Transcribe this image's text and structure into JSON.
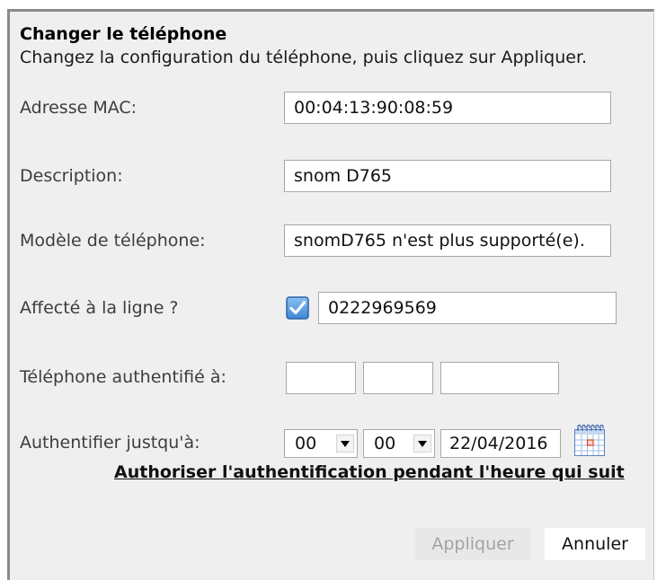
{
  "dialog": {
    "title": "Changer le téléphone",
    "subtitle": "Changez la configuration du téléphone, puis cliquez sur Appliquer."
  },
  "fields": {
    "mac": {
      "label": "Adresse MAC:",
      "value": "00:04:13:90:08:59"
    },
    "description": {
      "label": "Description:",
      "value": "snom D765"
    },
    "model": {
      "label": "Modèle de téléphone:",
      "value": "snomD765 n'est plus supporté(e)."
    },
    "line": {
      "label": "Affecté à la ligne ?",
      "checked": true,
      "value": "0222969569"
    },
    "authenticated": {
      "label": "Téléphone authentifié à:",
      "values": [
        "",
        "",
        ""
      ]
    },
    "auth_until": {
      "label": "Authentifier justqu'à:",
      "hour": "00",
      "minute": "00",
      "date": "22/04/2016"
    }
  },
  "link": {
    "label": "Authoriser l'authentification pendant l'heure qui suit"
  },
  "buttons": {
    "apply": {
      "label": "Appliquer",
      "disabled": true
    },
    "cancel": {
      "label": "Annuler"
    }
  },
  "icons": {
    "checkbox": "checkmark-icon",
    "dropdown": "chevron-down-icon",
    "calendar": "calendar-icon"
  },
  "colors": {
    "dialog_background": "#efefef",
    "dialog_border": "#8a8a8a",
    "checkbox_blue": "#3f86d6",
    "disabled_text": "#a3a3a3",
    "calendar_highlight": "#e0442b"
  }
}
